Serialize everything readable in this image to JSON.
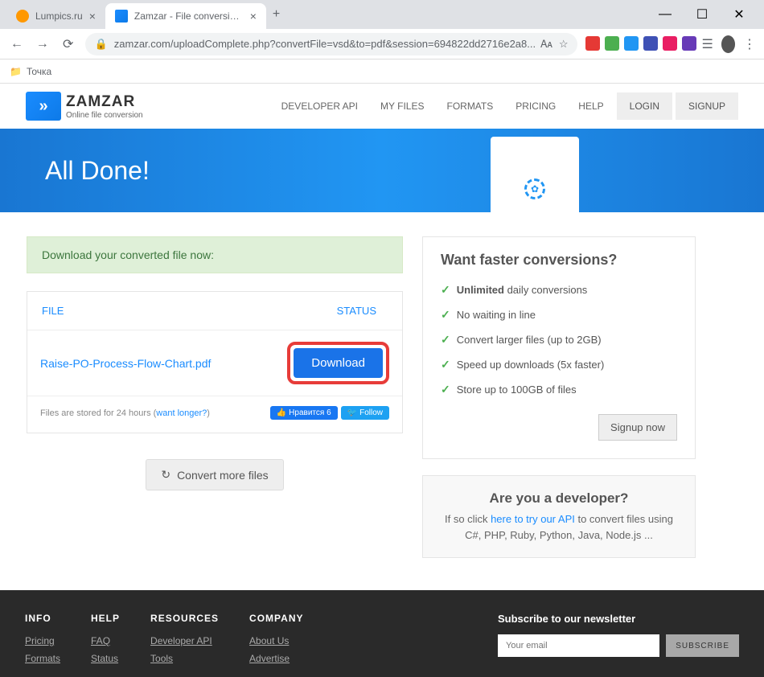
{
  "browser": {
    "tabs": [
      {
        "title": "Lumpics.ru",
        "fav": "orange"
      },
      {
        "title": "Zamzar - File conversion progres",
        "fav": "green"
      }
    ],
    "url": "zamzar.com/uploadComplete.php?convertFile=vsd&to=pdf&session=694822dd2716e2a8...",
    "bookmark": "Точка"
  },
  "header": {
    "logo_name": "ZAMZAR",
    "logo_tag": "Online file conversion",
    "nav": [
      "DEVELOPER API",
      "MY FILES",
      "FORMATS",
      "PRICING",
      "HELP"
    ],
    "login": "LOGIN",
    "signup": "SIGNUP"
  },
  "hero": {
    "title": "All Done!"
  },
  "alert": "Download your converted file now:",
  "table": {
    "col_file": "FILE",
    "col_status": "STATUS",
    "filename": "Raise-PO-Process-Flow-Chart.pdf",
    "download": "Download",
    "stored_prefix": "Files are stored for 24 hours (",
    "stored_link": "want longer?",
    "stored_suffix": ")",
    "fb_like": "Нравится 6",
    "tw_follow": "Follow"
  },
  "more_btn": "Convert more files",
  "promo": {
    "title": "Want faster conversions?",
    "items": [
      {
        "bold": "Unlimited",
        "rest": " daily conversions"
      },
      {
        "rest": "No waiting in line"
      },
      {
        "rest": "Convert larger files (up to 2GB)"
      },
      {
        "rest": "Speed up downloads (5x faster)"
      },
      {
        "rest": "Store up to 100GB of files"
      }
    ],
    "signup": "Signup now"
  },
  "dev": {
    "title": "Are you a developer?",
    "prefix": "If so click ",
    "link": "here to try our API",
    "mid": " to convert files using C#, PHP, Ruby, Python, Java, Node.js ..."
  },
  "footer": {
    "cols": [
      {
        "head": "INFO",
        "links": [
          "Pricing",
          "Formats"
        ]
      },
      {
        "head": "HELP",
        "links": [
          "FAQ",
          "Status"
        ]
      },
      {
        "head": "RESOURCES",
        "links": [
          "Developer API",
          "Tools"
        ]
      },
      {
        "head": "COMPANY",
        "links": [
          "About Us",
          "Advertise"
        ]
      }
    ],
    "sub_label": "Subscribe to our newsletter",
    "email_ph": "Your email",
    "sub_btn": "SUBSCRIBE"
  }
}
